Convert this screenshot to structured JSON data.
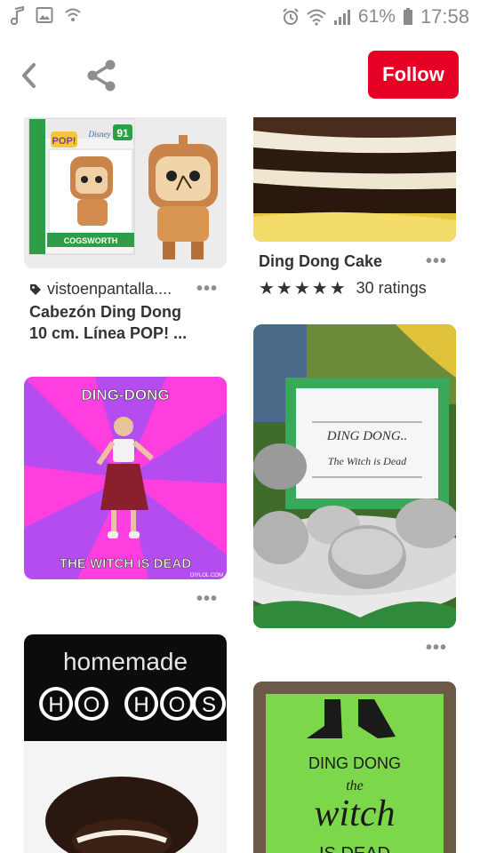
{
  "status_bar": {
    "battery": "61%",
    "time": "17:58",
    "icons": [
      "music-note-icon",
      "image-icon",
      "wifi-calling-icon",
      "alarm-icon",
      "wifi-icon",
      "signal-icon",
      "battery-icon"
    ]
  },
  "header": {
    "back_icon": "back-arrow-icon",
    "share_icon": "share-icon",
    "follow_label": "Follow",
    "follow_color": "#e60023"
  },
  "pins": {
    "cogsworth": {
      "box_brand": "POP!",
      "box_label": "COGSWORTH",
      "box_number": "91",
      "box_maker": "Disney",
      "source": "vistoenpantalla....",
      "title_line1": "Cabezón Ding Dong",
      "title_line2": "10 cm. Línea POP! ..."
    },
    "cake": {
      "title": "Ding Dong Cake",
      "stars": "★★★★★",
      "ratings": "30 ratings"
    },
    "meme": {
      "top_text": "DING-DONG",
      "bottom_text": "THE WITCH IS DEAD",
      "watermark": "DIYLOL.COM"
    },
    "cupcakes": {
      "sign_line1": "DING DONG..",
      "sign_line2": "The Witch is Dead"
    },
    "hohos": {
      "line1": "homemade",
      "letters": [
        "H",
        "O",
        "H",
        "O",
        "S"
      ]
    },
    "witch_sign": {
      "line1": "DING DONG",
      "line2": "the",
      "line3": "witch",
      "line4": "IS DEAD"
    }
  }
}
